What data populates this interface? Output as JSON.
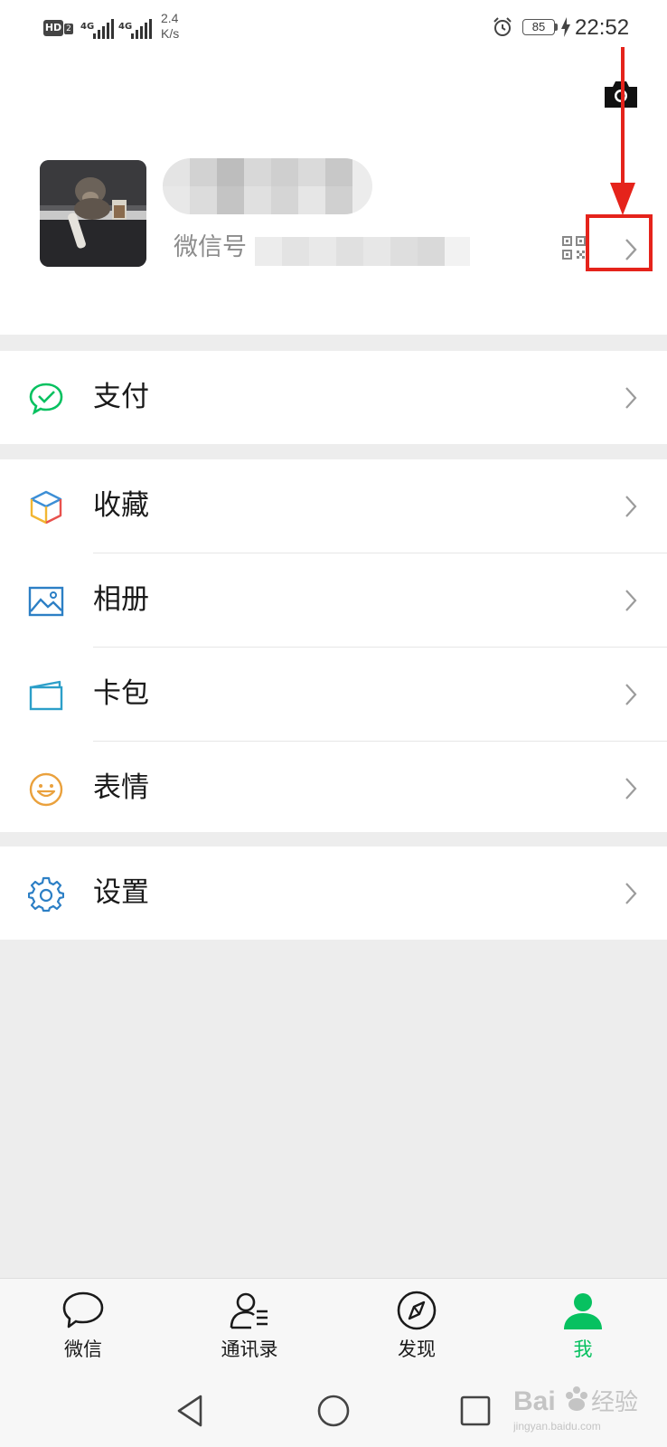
{
  "status_bar": {
    "hd_label": "HD",
    "hd_sub": "2",
    "sim1_label": "4G",
    "sim2_label": "4G",
    "speed_value": "2.4",
    "speed_unit": "K/s",
    "battery": "85",
    "time": "22:52",
    "icons": [
      "alarm-icon",
      "battery-icon",
      "charging-icon"
    ]
  },
  "profile": {
    "wechat_id_label": "微信号",
    "icons": [
      "camera-icon",
      "qr-code-icon",
      "chevron-right-icon"
    ]
  },
  "menu": {
    "pay": "支付",
    "favorites": "收藏",
    "album": "相册",
    "cards": "卡包",
    "stickers": "表情",
    "settings": "设置"
  },
  "tabs": [
    {
      "label": "微信",
      "icon": "chat-bubble-icon",
      "active": false
    },
    {
      "label": "通讯录",
      "icon": "contacts-icon",
      "active": false
    },
    {
      "label": "发现",
      "icon": "compass-icon",
      "active": false
    },
    {
      "label": "我",
      "icon": "person-icon",
      "active": true
    }
  ],
  "watermark": {
    "text": "Baidu经验",
    "sub": "jingyan.baidu.com"
  },
  "colors": {
    "accent_green": "#07c160",
    "annotation_red": "#e5231b",
    "background": "#ededed",
    "text": "#1a1a1a",
    "secondary_text": "#8c8c8c"
  }
}
